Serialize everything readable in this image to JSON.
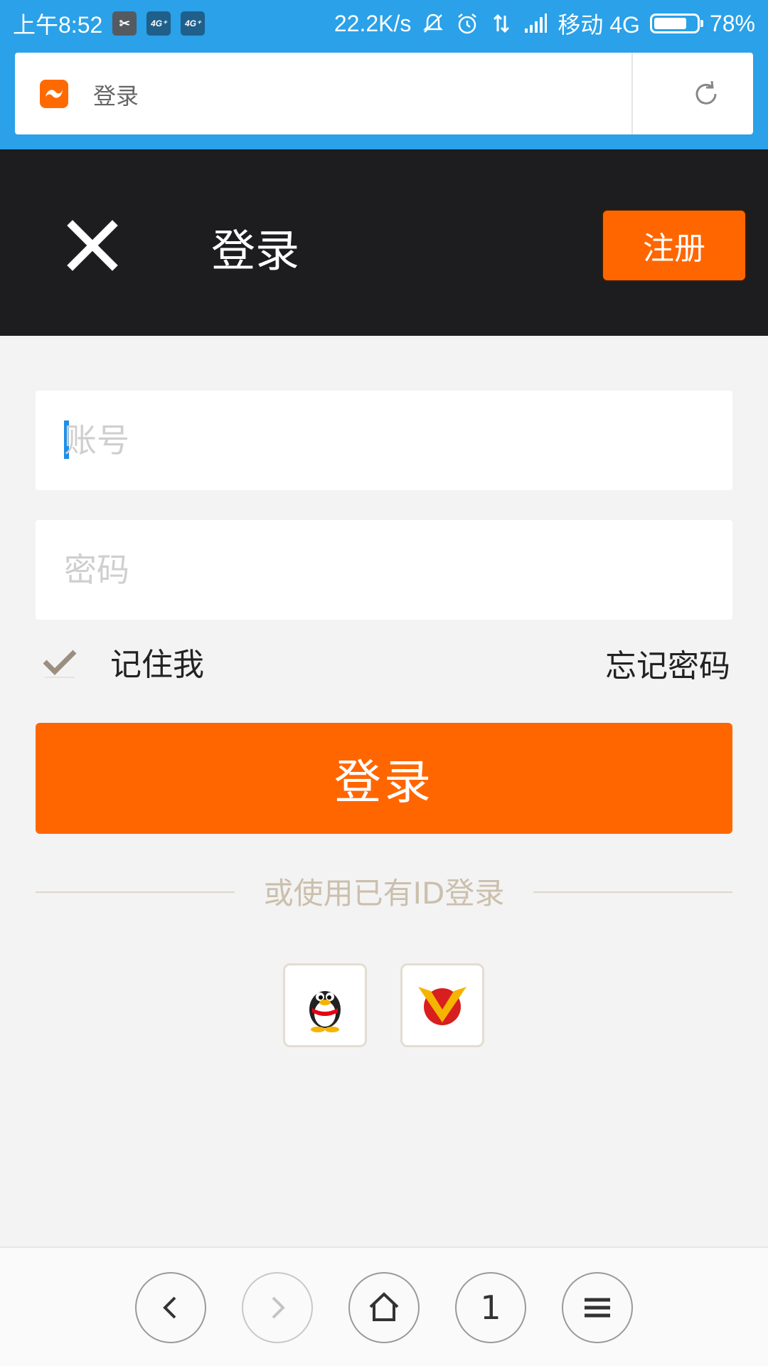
{
  "status_bar": {
    "time": "上午8:52",
    "net_speed": "22.2K/s",
    "carrier": "移动 4G",
    "battery": "78%",
    "battery_level": 0.78,
    "chip_4g_1": "4G⁺",
    "chip_4g_2": "4G⁺"
  },
  "browser": {
    "page_title": "登录",
    "tab_count": "1"
  },
  "header": {
    "title": "登录",
    "register_label": "注册"
  },
  "form": {
    "account_placeholder": "账号",
    "password_placeholder": "密码",
    "remember_label": "记住我",
    "forgot_label": "忘记密码",
    "login_label": "登录"
  },
  "alt_login": {
    "text": "或使用已有ID登录"
  },
  "colors": {
    "accent": "#ff6600",
    "status_bar": "#2aa1e8",
    "header_bg": "#1d1d1f"
  },
  "icons": [
    "close-icon",
    "refresh-icon",
    "check-icon",
    "qq-icon",
    "vip-icon",
    "back-icon",
    "forward-icon",
    "home-icon",
    "menu-icon"
  ]
}
